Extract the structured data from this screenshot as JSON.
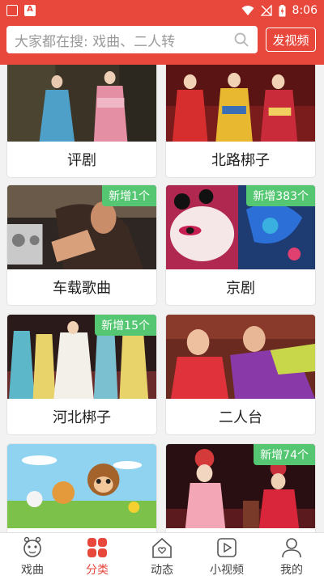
{
  "status_bar": {
    "time": "8:06"
  },
  "search": {
    "placeholder": "大家都在搜: 戏曲、二人转"
  },
  "header": {
    "publish_label": "发视频"
  },
  "cards": [
    {
      "label": "评剧",
      "badge": ""
    },
    {
      "label": "北路梆子",
      "badge": ""
    },
    {
      "label": "车载歌曲",
      "badge": "新增1个"
    },
    {
      "label": "京剧",
      "badge": "新增383个"
    },
    {
      "label": "河北梆子",
      "badge": "新增15个"
    },
    {
      "label": "二人台",
      "badge": ""
    },
    {
      "label": "",
      "badge": ""
    },
    {
      "label": "",
      "badge": "新增74个"
    }
  ],
  "tabs": [
    {
      "label": "戏曲",
      "icon": "opera-face-icon",
      "active": false
    },
    {
      "label": "分类",
      "icon": "category-grid-icon",
      "active": true
    },
    {
      "label": "动态",
      "icon": "house-heart-icon",
      "active": false
    },
    {
      "label": "小视频",
      "icon": "play-video-icon",
      "active": false
    },
    {
      "label": "我的",
      "icon": "user-icon",
      "active": false
    }
  ],
  "colors": {
    "brand": "#e8473c",
    "badge": "#55c672",
    "active_tab": "#e8473c"
  }
}
